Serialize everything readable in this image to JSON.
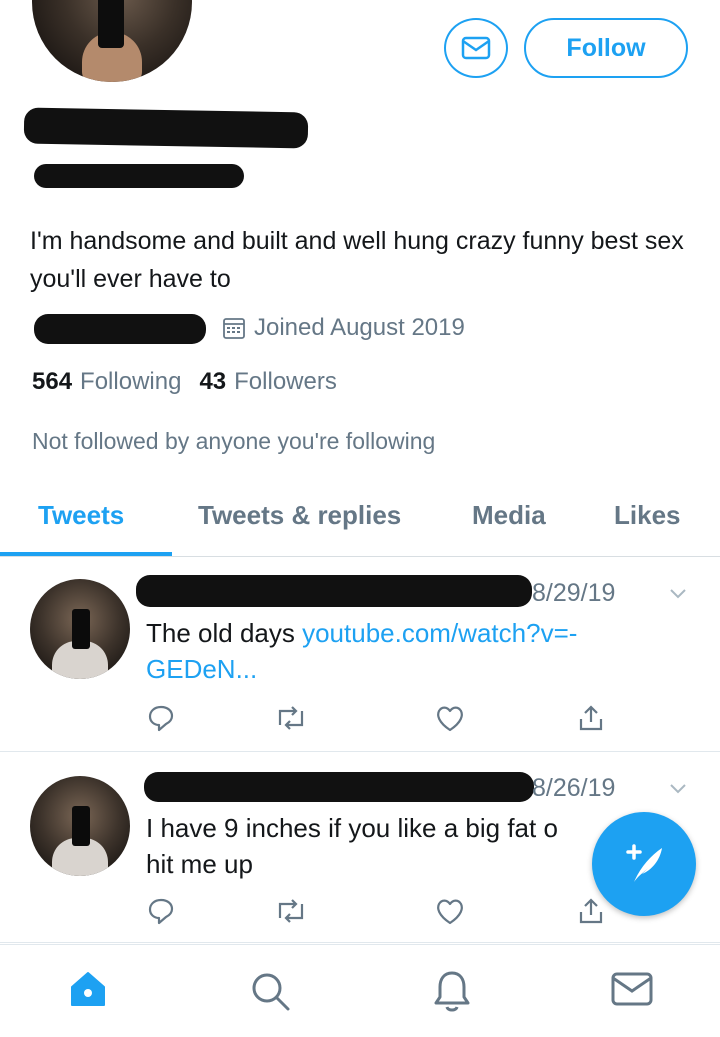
{
  "profile": {
    "bio": "I'm handsome and built and well hung crazy funny best sex you'll ever have to",
    "joined": "Joined August 2019",
    "following_count": "564",
    "following_label": "Following",
    "followers_count": "43",
    "followers_label": "Followers",
    "not_followed_text": "Not followed by anyone you're following"
  },
  "header": {
    "follow_label": "Follow",
    "message_icon": "mail-icon"
  },
  "tabs": [
    {
      "label": "Tweets",
      "active": true
    },
    {
      "label": "Tweets & replies",
      "active": false
    },
    {
      "label": "Media",
      "active": false
    },
    {
      "label": "Likes",
      "active": false
    }
  ],
  "tweets": [
    {
      "date": "8/29/19",
      "text": "The old days ",
      "link": "youtube.com/watch?v=-GEDeN..."
    },
    {
      "date": "8/26/19",
      "text": "I have 9 inches if you like a big fat o",
      "text2": "hit me up",
      "link": ""
    }
  ],
  "actions": [
    "reply-icon",
    "retweet-icon",
    "like-icon",
    "share-icon"
  ],
  "nav": [
    "home-icon",
    "search-icon",
    "notifications-icon",
    "messages-icon"
  ],
  "fab_icon": "compose-tweet-icon",
  "colors": {
    "accent": "#1da1f2",
    "muted": "#657786",
    "text": "#14171a"
  }
}
